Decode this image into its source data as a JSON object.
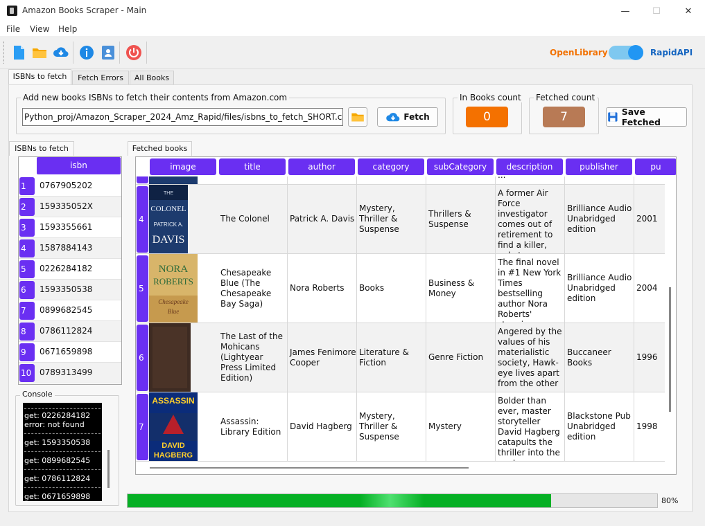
{
  "window": {
    "title": "Amazon Books Scraper - Main",
    "minimize": "—",
    "maximize": "☐",
    "close": "✕"
  },
  "menu": [
    "File",
    "View",
    "Help"
  ],
  "toolbar": {
    "icons": [
      "new-file-icon",
      "open-folder-icon",
      "cloud-download-icon",
      "info-icon",
      "contacts-icon",
      "power-icon"
    ],
    "api_left": "OpenLibrary",
    "api_right": "RapidAPI",
    "toggle_on": true,
    "colors": {
      "openlibrary": "#f27100",
      "rapidapi": "#1565c0",
      "toggle_track": "#7ec8f0",
      "toggle_knob": "#2196f3"
    }
  },
  "tabs": [
    "ISBNs to fetch",
    "Fetch Errors",
    "All Books"
  ],
  "fetch_group": {
    "title": "Add new books ISBNs to fetch their contents from Amazon.com",
    "path": "Python_proj/Amazon_Scraper_2024_Amz_Rapid/files/isbns_to_fetch_SHORT.csv",
    "fetch_label": "Fetch",
    "save_label": "Save Fetched"
  },
  "counts": {
    "in_books_title": "In Books count",
    "in_books_value": "0",
    "in_books_color": "#f47100",
    "fetched_title": "Fetched count",
    "fetched_value": "7",
    "fetched_color": "#b87a55"
  },
  "isbn_panel": {
    "title": "ISBNs to fetch",
    "header": "isbn",
    "rows": [
      {
        "n": "1",
        "isbn": "0767905202"
      },
      {
        "n": "2",
        "isbn": "159335052X"
      },
      {
        "n": "3",
        "isbn": "1593355661"
      },
      {
        "n": "4",
        "isbn": "1587884143"
      },
      {
        "n": "5",
        "isbn": "0226284182"
      },
      {
        "n": "6",
        "isbn": "1593350538"
      },
      {
        "n": "7",
        "isbn": "0899682545"
      },
      {
        "n": "8",
        "isbn": "0786112824"
      },
      {
        "n": "9",
        "isbn": "0671659898"
      },
      {
        "n": "10",
        "isbn": "0789313499"
      }
    ]
  },
  "console": {
    "title": "Console",
    "lines": [
      "get: 0226284182",
      "error: not found",
      "get: 1593350538",
      "get: 0899682545",
      "get: 0786112824",
      "get: 0671659898"
    ]
  },
  "fetched_panel": {
    "title": "Fetched books",
    "columns": [
      "image",
      "title",
      "author",
      "category",
      "subCategory",
      "description",
      "publisher",
      "pu"
    ],
    "partial_row_description": "a killer, only to ...",
    "rows": [
      {
        "n": "4",
        "title": "The Colonel",
        "author": "Patrick A. Davis",
        "category": "Mystery, Thriller & Suspense",
        "subCategory": "Thrillers & Suspense",
        "description": "A former Air Force investigator comes out of retirement to find a killer, only to ...",
        "publisher": "Brilliance Audio Unabridged edition",
        "year": "2001",
        "cover_text": [
          "THE",
          "COLONEL",
          "PATRICK A.",
          "DAVIS"
        ]
      },
      {
        "n": "5",
        "title": "Chesapeake Blue (The Chesapeake Bay Saga)",
        "author": "Nora Roberts",
        "category": "Books",
        "subCategory": "Business & Money",
        "description": "The final novel in #1 New York Times bestselling author Nora Roberts' stunning Chesapeake Ba...",
        "publisher": "Brilliance Audio Unabridged edition",
        "year": "2004",
        "cover_text": [
          "NORA",
          "ROBERTS",
          "Chesapeake",
          "Blue"
        ]
      },
      {
        "n": "6",
        "title": "The Last of the Mohicans (Lightyear Press Limited Edition)",
        "author": "James Fenimore Cooper",
        "category": "Literature & Fiction",
        "subCategory": "Genre Fiction",
        "description": "Angered by the values of his materialistic society, Hawk-eye lives apart from the other ...",
        "publisher": "Buccaneer Books",
        "year": "1996",
        "cover_text": []
      },
      {
        "n": "7",
        "title": "Assassin: Library Edition",
        "author": "David Hagberg",
        "category": "Mystery, Thriller & Suspense",
        "subCategory": "Mystery",
        "description": "Bolder than ever, master storyteller David Hagberg catapults the thriller into the next millenniu...",
        "publisher": "Blackstone Pub Unabridged edition",
        "year": "1998",
        "cover_text": [
          "ASSASSIN",
          "DAVID",
          "HAGBERG"
        ]
      }
    ]
  },
  "progress": {
    "value": 0.8,
    "label": "80%"
  },
  "colors": {
    "accent": "#6a2ff2",
    "progress": "#06b025"
  }
}
